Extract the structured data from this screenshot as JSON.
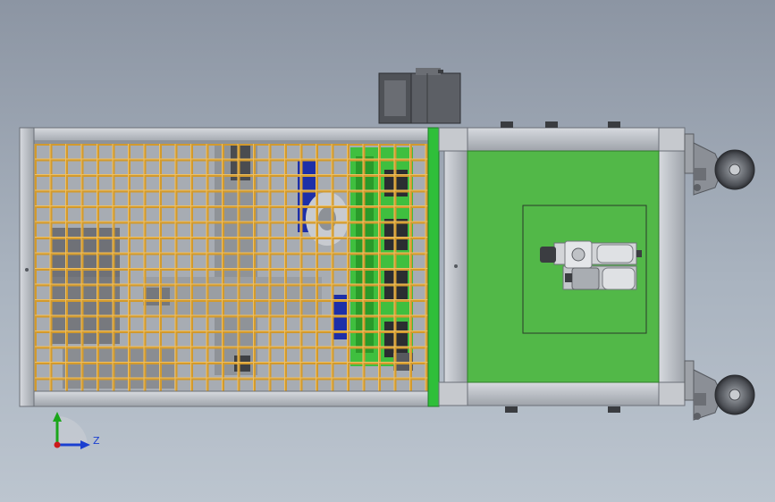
{
  "viewport": {
    "background_top": "#8c95a3",
    "background_bottom": "#bcc5cf"
  },
  "triad": {
    "horizontal_axis_label": "Z",
    "vertical_axis_color": "#1aa61a",
    "horizontal_axis_color": "#1a3fd0",
    "origin_color": "#cc1a1a"
  },
  "model_colors": {
    "frame": "#b8bcc2",
    "cage_mesh": "#d29a2e",
    "panel": "#52b848",
    "accent_green": "#2fbf3a",
    "motor": "#5a5d63",
    "blue_part": "#1d2fa8",
    "caster": "#8b8f96"
  }
}
